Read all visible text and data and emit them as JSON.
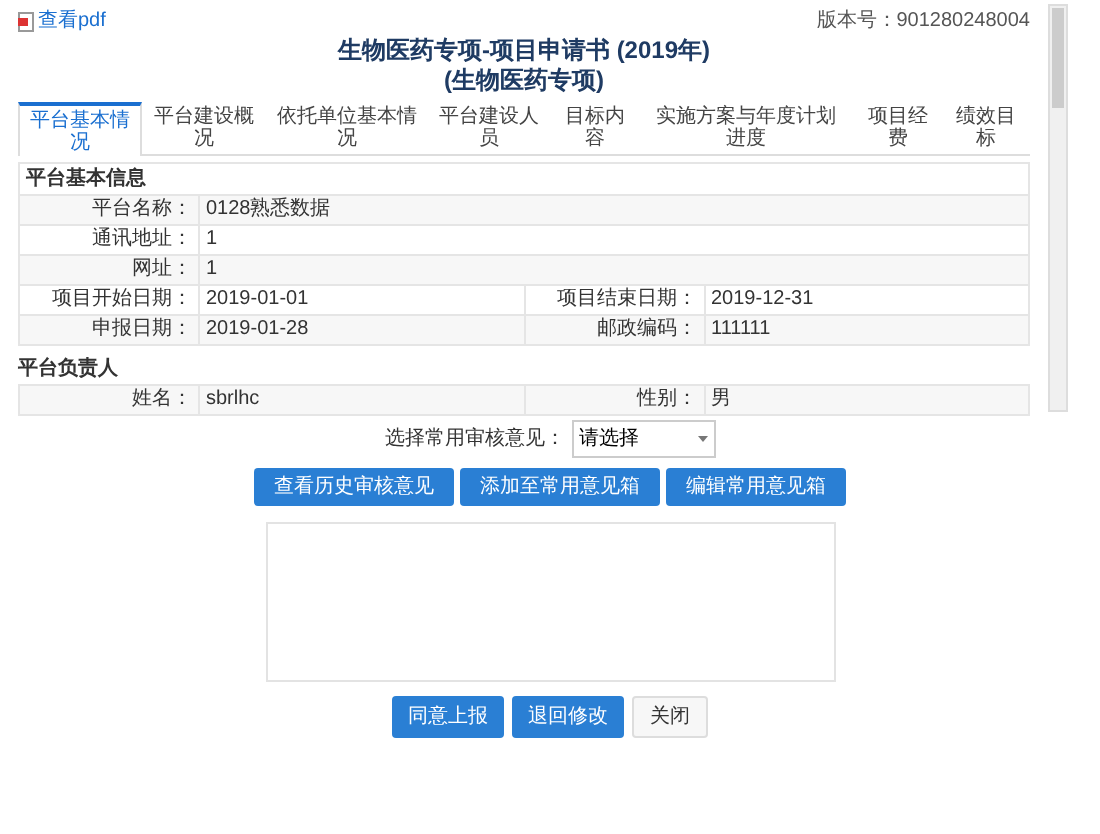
{
  "pdf_link": "查看pdf",
  "version": "版本号：901280248004",
  "title": "生物医药专项-项目申请书 (2019年)",
  "subtitle": "(生物医药专项)",
  "tabs": [
    {
      "label": "平台基本情况",
      "selected": true
    },
    {
      "label": "平台建设概况",
      "selected": false
    },
    {
      "label": "依托单位基本情况",
      "selected": false
    },
    {
      "label": "平台建设人员",
      "selected": false
    },
    {
      "label": "目标内容",
      "selected": false
    },
    {
      "label": "实施方案与年度计划进度",
      "selected": false
    },
    {
      "label": "项目经费",
      "selected": false
    },
    {
      "label": "绩效目标",
      "selected": false
    }
  ],
  "sections": [
    {
      "title": "平台基本信息",
      "rows": [
        [
          {
            "label": "平台名称：",
            "value": "0128熟悉数据"
          }
        ],
        [
          {
            "label": "通讯地址：",
            "value": "1"
          }
        ],
        [
          {
            "label": "网址：",
            "value": "1"
          }
        ],
        [
          {
            "label": "项目开始日期：",
            "value": "2019-01-01"
          },
          {
            "label": "项目结束日期：",
            "value": "2019-12-31"
          }
        ],
        [
          {
            "label": "申报日期：",
            "value": "2019-01-28"
          },
          {
            "label": "邮政编码：",
            "value": "111111"
          }
        ]
      ]
    },
    {
      "title": "平台负责人",
      "rows": [
        [
          {
            "label": "姓名：",
            "value": "sbrlhc"
          },
          {
            "label": "性别：",
            "value": "男"
          }
        ]
      ]
    }
  ],
  "review": {
    "label": "选择常用审核意见：",
    "select_value": "请选择",
    "tool_buttons": [
      "查看历史审核意见",
      "添加至常用意见箱",
      "编辑常用意见箱"
    ],
    "actions": [
      {
        "label": "同意上报",
        "kind": "primary"
      },
      {
        "label": "退回修改",
        "kind": "primary"
      },
      {
        "label": "关闭",
        "kind": "plain"
      }
    ]
  }
}
